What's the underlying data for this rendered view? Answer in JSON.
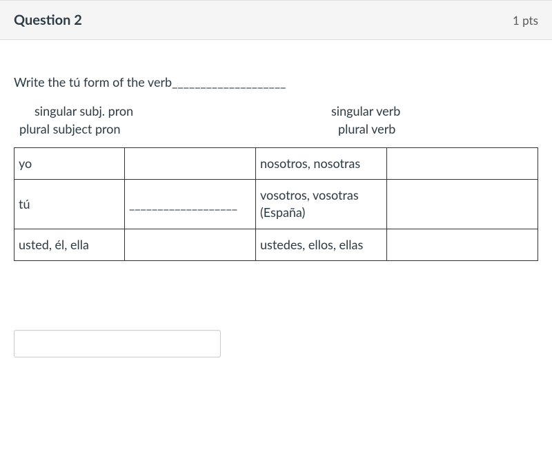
{
  "header": {
    "title": "Question 2",
    "points": "1 pts"
  },
  "prompt": "Write the tú form of the verb____________________",
  "labels": {
    "singularSubj": "singular subj. pron",
    "singularVerb": "singular verb",
    "pluralSubj": "plural subject pron",
    "pluralVerb": "plural verb"
  },
  "table": {
    "r1": {
      "sgPron": "yo",
      "sgVerb": "",
      "plPron": "nosotros, nosotras",
      "plVerb": ""
    },
    "r2": {
      "sgPron": "tú",
      "sgVerb": "___________________",
      "plPron": "vosotros, vosotras (España)",
      "plVerb": ""
    },
    "r3": {
      "sgPron": "usted, él, ella",
      "sgVerb": "",
      "plPron": "ustedes, ellos, ellas",
      "plVerb": ""
    }
  },
  "input": {
    "value": ""
  }
}
